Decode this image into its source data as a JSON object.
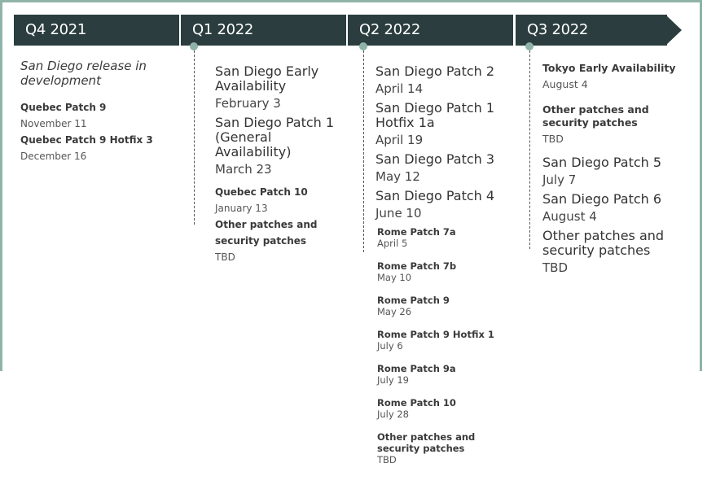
{
  "quarters": [
    {
      "label": "Q4 2021"
    },
    {
      "label": "Q1 2022"
    },
    {
      "label": "Q2 2022"
    },
    {
      "label": "Q3 2022"
    }
  ],
  "q4_2021": {
    "note": "San Diego release in development",
    "items": [
      {
        "title": "Quebec Patch 9",
        "date": "November 11"
      },
      {
        "title": "Quebec Patch 9 Hotfix 3",
        "date": "December 16"
      }
    ]
  },
  "q1_2022": {
    "major": [
      {
        "title": "San Diego Early Availability",
        "date": "February 3"
      },
      {
        "title": "San Diego Patch 1 (General Availability)",
        "date": "March 23"
      }
    ],
    "minor": [
      {
        "title": "Quebec Patch 10",
        "date": "January 13"
      },
      {
        "title": "Other patches and security patches",
        "date": "TBD"
      }
    ]
  },
  "q2_2022": {
    "major": [
      {
        "title": "San Diego Patch 2",
        "date": "April 14"
      },
      {
        "title": "San Diego Patch 1 Hotfix 1a",
        "date": "April 19"
      },
      {
        "title": "San Diego Patch 3",
        "date": "May 12"
      },
      {
        "title": "San Diego Patch 4",
        "date": "June 10"
      }
    ],
    "minor": [
      {
        "title": "Rome Patch 7a",
        "date": "April 5"
      },
      {
        "title": "Rome Patch 7b",
        "date": "May 10"
      },
      {
        "title": "Rome Patch 9",
        "date": "May 26"
      },
      {
        "title": "Rome Patch 9 Hotfix 1",
        "date": "July 6"
      },
      {
        "title": "Rome Patch 9a",
        "date": "July 19"
      },
      {
        "title": "Rome Patch 10",
        "date": "July 28"
      },
      {
        "title": "Other patches and security patches",
        "date": "TBD"
      }
    ]
  },
  "q3_2022": {
    "minor": [
      {
        "title": "Tokyo Early Availability",
        "date": "August 4"
      },
      {
        "title": "Other patches and security patches",
        "date": "TBD"
      }
    ],
    "major": [
      {
        "title": "San Diego Patch 5",
        "date": "July 7"
      },
      {
        "title": "San Diego Patch 6",
        "date": "August 4"
      },
      {
        "title": "Other patches and security patches",
        "date": "TBD"
      }
    ]
  },
  "colors": {
    "header_bg": "#2b3d3f",
    "header_text": "#ffffff",
    "accent": "#8fb3a8"
  }
}
